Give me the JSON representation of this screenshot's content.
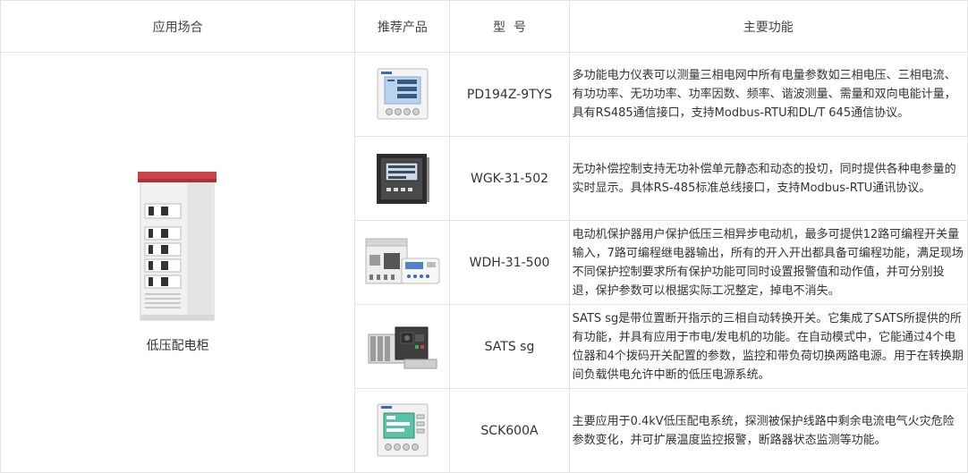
{
  "header": {
    "application": "应用场合",
    "product": "推荐产品",
    "model": "型  号",
    "function": "主要功能"
  },
  "application_name": "低压配电柜",
  "rows": [
    {
      "image_icon": "power-meter-icon",
      "model": "PD194Z-9TYS",
      "description": "多功能电力仪表可以测量三相电网中所有电量参数如三相电压、三相电流、有功功率、无功功率、功率因数、频率、谐波测量、需量和双向电能计量，具有RS485通信接口，支持Modbus-RTU和DL/T 645通信协议。"
    },
    {
      "image_icon": "reactive-compensation-controller-icon",
      "model": "WGK-31-502",
      "description": "无功补偿控制支持无功补偿单元静态和动态的投切，同时提供各种电参量的实时显示。具体RS-485标准总线接口，支持Modbus-RTU通讯协议。"
    },
    {
      "image_icon": "motor-protector-icon",
      "model": "WDH-31-500",
      "description": "电动机保护器用户保护低压三相异步电动机，最多可提供12路可编程开关量输入，7路可编程继电器输出，所有的开入开出都具备可编程功能，满足现场不同保护控制要求所有保护功能可同时设置报警值和动作值，并可分别投退，保护参数可以根据实际工况整定，掉电不消失。"
    },
    {
      "image_icon": "transfer-switch-icon",
      "model": "SATS sg",
      "description": "SATS sg是带位置断开指示的三相自动转换开关。它集成了SATS所提供的所有功能，并具有应用于市电/发电机的功能。在自动模式中，它能通过4个电位器和4个拨码开关配置的参数，监控和带负荷切换两路电源。用于在转换期间负载供电允许中断的低压电源系统。"
    },
    {
      "image_icon": "residual-current-monitor-icon",
      "model": "SCK600A",
      "description": "主要应用于0.4kV低压配电系统，探测被保护线路中剩余电流电气火灾危险参数变化，并可扩展温度监控报警，断路器状态监测等功能。"
    }
  ],
  "colors": {
    "border": "#e4e4e4",
    "cabinet_top": "#c9454a",
    "meter_screen": "#b9d3ef",
    "rcm_screen": "#59c3a8"
  }
}
